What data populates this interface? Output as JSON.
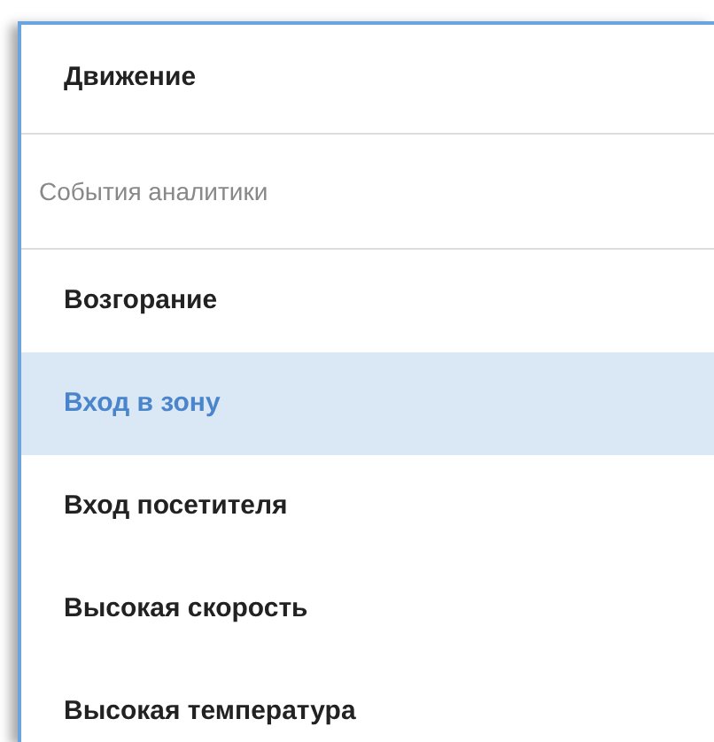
{
  "header": {
    "title": "Движение"
  },
  "section": {
    "label": "События аналитики"
  },
  "items": [
    {
      "label": "Возгорание",
      "selected": false
    },
    {
      "label": "Вход в зону",
      "selected": true
    },
    {
      "label": "Вход посетителя",
      "selected": false
    },
    {
      "label": "Высокая скорость",
      "selected": false
    },
    {
      "label": "Высокая температура",
      "selected": false
    }
  ]
}
